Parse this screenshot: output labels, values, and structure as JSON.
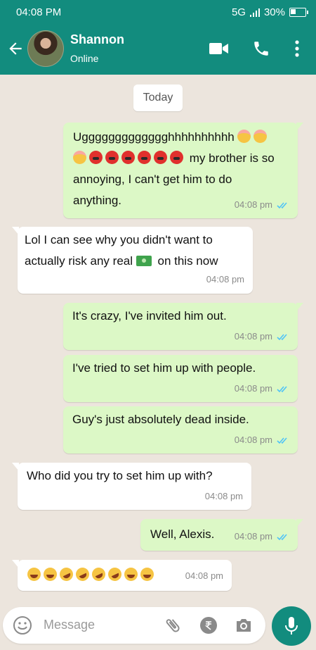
{
  "status_bar": {
    "time": "04:08 PM",
    "network": "5G",
    "battery": "30%",
    "battery_level": 0.3
  },
  "header": {
    "contact_name": "Shannon",
    "status": "Online"
  },
  "icons": {
    "back": "arrow-left-icon",
    "video": "video-call-icon",
    "call": "phone-icon",
    "menu": "more-vertical-icon",
    "emoji": "emoji-icon",
    "attach": "attachment-icon",
    "payment": "rupee-icon",
    "camera": "camera-icon",
    "mic": "microphone-icon"
  },
  "date_chip": "Today",
  "messages": [
    {
      "direction": "out",
      "line1": "Uggggggggggggghhhhhhhhhh",
      "line2": "my brother is so",
      "line3": "annoying, I can't get him to do",
      "line4": "anything.",
      "time": "04:08 pm",
      "read": true
    },
    {
      "direction": "in",
      "line1": "Lol I can see why you didn't want to",
      "line2a": "actually risk any real",
      "line2b": "on this now",
      "time": "04:08 pm"
    },
    {
      "direction": "out",
      "text": "It's crazy, I've invited him out.",
      "time": "04:08 pm",
      "read": true
    },
    {
      "direction": "out",
      "text": "I've tried to set him up with people.",
      "time": "04:08 pm",
      "read": true
    },
    {
      "direction": "out",
      "text": "Guy's just absolutely dead inside.",
      "time": "04:08 pm",
      "read": true
    },
    {
      "direction": "in",
      "text": "Who did you try to set him up with?",
      "time": "04:08 pm"
    },
    {
      "direction": "out",
      "text": "Well, Alexis.",
      "time": "04:08 pm",
      "read": true
    },
    {
      "direction": "in",
      "text": "",
      "time": "04:08 pm"
    }
  ],
  "composer": {
    "placeholder": "Message"
  },
  "colors": {
    "primary": "#128c7e",
    "outgoing": "#dcf8c6",
    "incoming": "#ffffff",
    "background": "#ece5dd",
    "read_tick": "#4fc3f7"
  }
}
